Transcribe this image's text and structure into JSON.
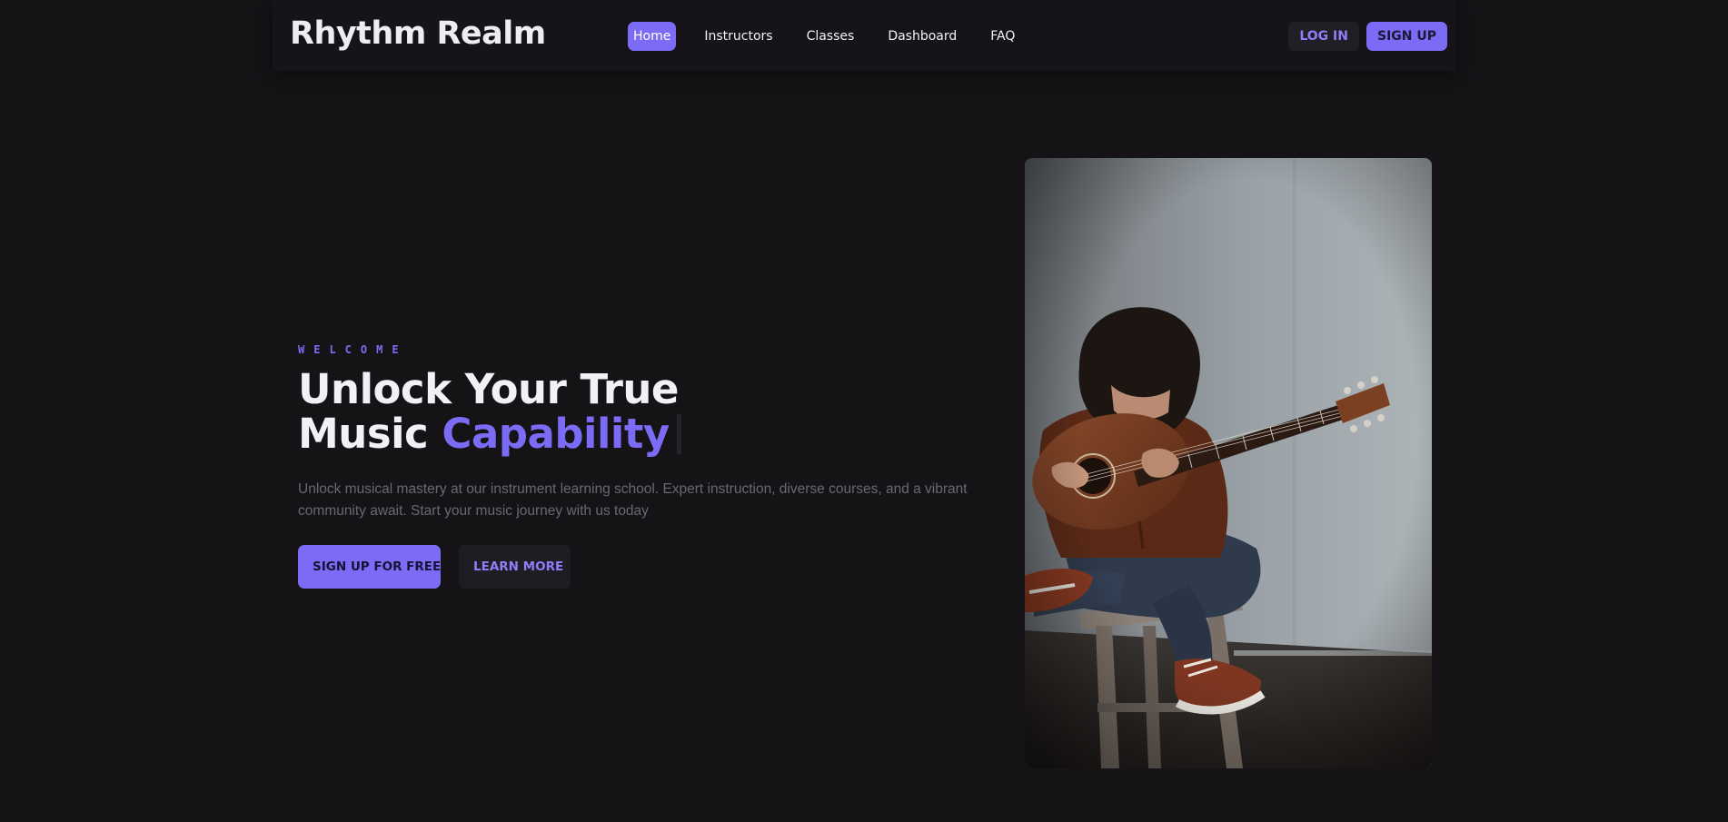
{
  "brand": {
    "name": "Rhythm Realm"
  },
  "nav": {
    "links": [
      {
        "label": "Home",
        "active": true
      },
      {
        "label": "Instructors",
        "active": false
      },
      {
        "label": "Classes",
        "active": false
      },
      {
        "label": "Dashboard",
        "active": false
      },
      {
        "label": "FAQ",
        "active": false
      }
    ],
    "login_label": "LOG IN",
    "signup_label": "SIGN UP"
  },
  "hero": {
    "eyebrow": "WELCOME",
    "headline_line1": "Unlock Your True",
    "headline_line2_prefix": "Music ",
    "headline_accent": "Capability",
    "description": "Unlock musical mastery at our instrument learning school. Expert instruction, diverse courses, and a vibrant community await. Start your music journey with us today",
    "primary_cta": "SIGN UP FOR FREE",
    "secondary_cta": "LEARN MORE"
  },
  "photo": {
    "subject": "person playing acoustic guitar seated on a stool"
  },
  "colors": {
    "background": "#151316",
    "accent": "#7c6cf5",
    "text": "#f3f1f5",
    "muted_text": "#6b6870"
  }
}
